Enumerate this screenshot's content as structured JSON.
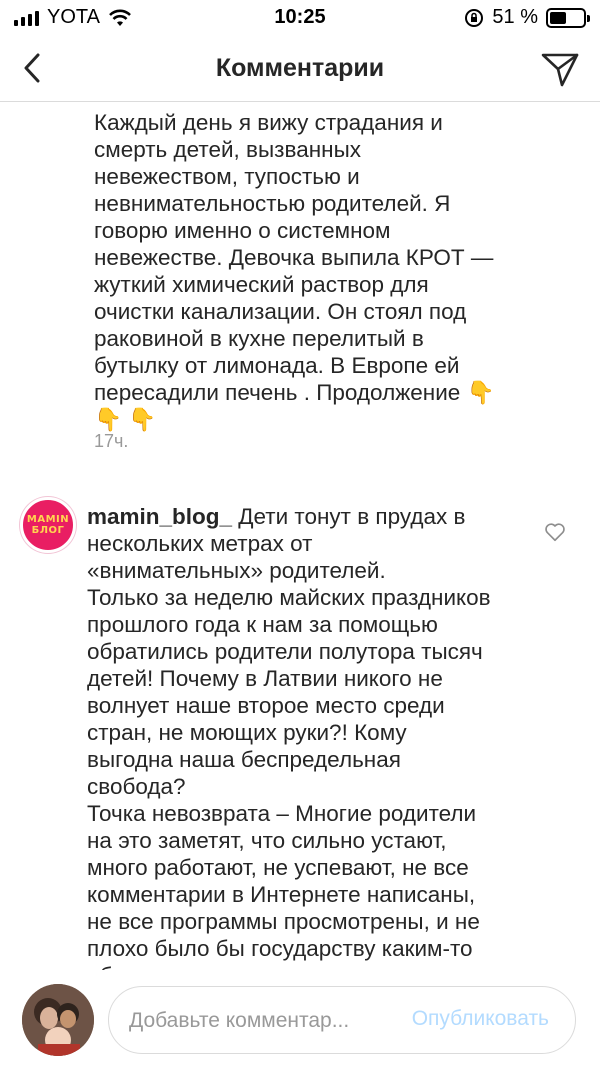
{
  "status_bar": {
    "carrier": "YOTA",
    "time": "10:25",
    "battery_percent_label": "51 %",
    "battery_level": 0.51
  },
  "header": {
    "title": "Комментарии"
  },
  "comments": [
    {
      "text": "Каждый день я вижу страдания и\nсмерть детей, вызванных\nневежеством, тупостью и\nневнимательностью родителей. Я\nговорю именно о системном\nневежестве. Девочка выпила КРОТ —\nжуткий химический раствор для\nочистки канализации. Он стоял под\nраковиной в кухне перелитый в\nбутылку от лимонада. В Европе ей\nпересадили печень . Продолжение 👇\n👇 👇",
      "time": "17ч."
    },
    {
      "username": "mamin_blog_",
      "text": " Дети тонут в прудах в\nнескольких метрах от\n«внимательных» родителей.\nТолько за неделю майских праздников\nпрошлого года к нам за помощью\nобратились родители полутора тысяч\nдетей! Почему в Латвии никого не\nволнует наше второе место среди\nстран, не моющих руки?! Кому\nвыгодна наша беспредельная\nсвобода?\nТочка невозврата – Многие родители\nна это заметят, что сильно устают,\nмного работают, не успевают, не все\nкомментарии в Интернете написаны,\nне все программы просмотрены, и не\nплохо было бы государству каким-то\nобразом поддержать семьи с детьми.",
      "avatar_text": [
        "MAMIN",
        "БЛОГ"
      ]
    }
  ],
  "composer": {
    "placeholder": "Добавьте комментар...",
    "publish_label": "Опубликовать"
  },
  "colors": {
    "text": "#262626",
    "muted": "#999999",
    "divider": "#dbdbdb",
    "publish_disabled": "#b3dbff",
    "brand_pink": "#e91e63"
  },
  "icons": [
    "signal-icon",
    "wifi-icon",
    "rotation-lock-icon",
    "battery-icon",
    "back-arrow-icon",
    "direct-send-icon",
    "heart-icon"
  ]
}
